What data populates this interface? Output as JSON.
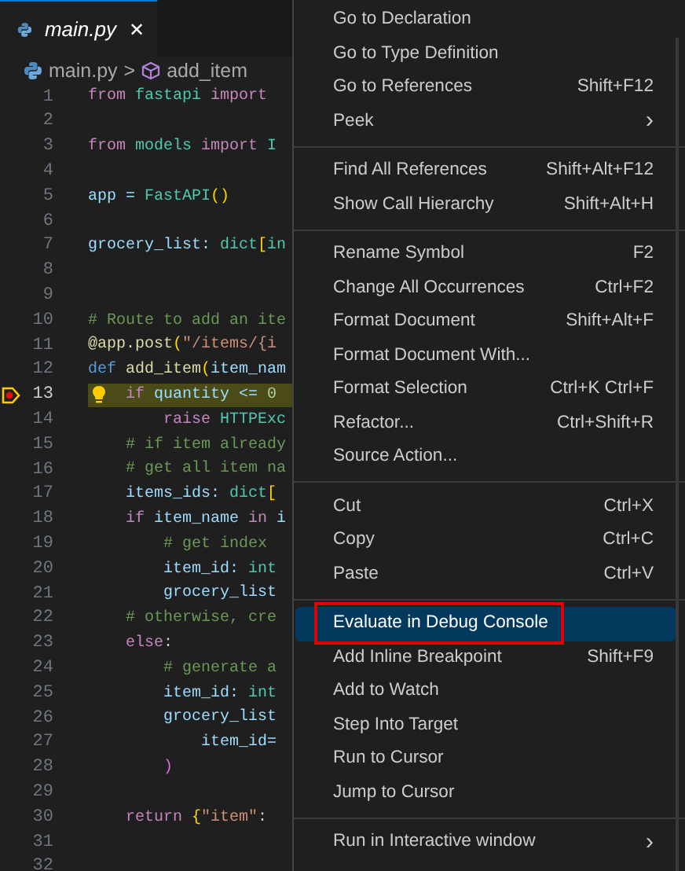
{
  "tab": {
    "label": "main.py",
    "selected": true,
    "close": "✕"
  },
  "breadcrumb": {
    "file": "main.py",
    "separator": ">",
    "symbol": "add_item"
  },
  "lines": [
    {
      "n": "1",
      "current": false,
      "tokens": [
        {
          "kind": "kw",
          "t": "from "
        },
        {
          "kind": "type",
          "t": "fastapi "
        },
        {
          "kind": "kw",
          "t": "import"
        }
      ]
    },
    {
      "n": "2",
      "current": false
    },
    {
      "n": "3",
      "current": false,
      "tokens": [
        {
          "kind": "kw",
          "t": "from "
        },
        {
          "kind": "type",
          "t": "models "
        },
        {
          "kind": "kw",
          "t": "import "
        },
        {
          "kind": "type",
          "t": "I"
        }
      ]
    },
    {
      "n": "4",
      "current": false
    },
    {
      "n": "5",
      "current": false,
      "tokens": [
        {
          "kind": "var",
          "t": "app = "
        },
        {
          "kind": "type",
          "t": "FastAPI"
        },
        {
          "kind": "br",
          "t": "()"
        }
      ]
    },
    {
      "n": "6",
      "current": false
    },
    {
      "n": "7",
      "current": false,
      "tokens": [
        {
          "kind": "var",
          "t": "grocery_list: "
        },
        {
          "kind": "type",
          "t": "dict"
        },
        {
          "kind": "br",
          "t": "["
        },
        {
          "kind": "type",
          "t": "in"
        }
      ]
    },
    {
      "n": "8",
      "current": false
    },
    {
      "n": "9",
      "current": false
    },
    {
      "n": "10",
      "current": false,
      "tokens": [
        {
          "kind": "cm",
          "t": "# Route to add an ite"
        }
      ]
    },
    {
      "n": "11",
      "current": false,
      "tokens": [
        {
          "kind": "fn",
          "t": "@app.post"
        },
        {
          "kind": "br",
          "t": "("
        },
        {
          "kind": "str",
          "t": "\"/items/{i"
        }
      ]
    },
    {
      "n": "12",
      "current": false,
      "tokens": [
        {
          "kind": "def",
          "t": "def "
        },
        {
          "kind": "fn",
          "t": "add_item"
        },
        {
          "kind": "br",
          "t": "("
        },
        {
          "kind": "var",
          "t": "item_nam"
        }
      ]
    },
    {
      "n": "13",
      "current": true,
      "tokens": [
        {
          "kind": "kw",
          "t": "if "
        },
        {
          "kind": "var",
          "t": "quantity <= "
        },
        {
          "kind": "num",
          "t": "0"
        }
      ]
    },
    {
      "n": "14",
      "current": false,
      "tokens": [
        {
          "kind": "kw",
          "t": "        raise "
        },
        {
          "kind": "type",
          "t": "HTTPExc"
        }
      ]
    },
    {
      "n": "15",
      "current": false,
      "tokens": [
        {
          "kind": "cm",
          "t": "    # if item already"
        }
      ]
    },
    {
      "n": "16",
      "current": false,
      "tokens": [
        {
          "kind": "cm",
          "t": "    # get all item na"
        }
      ]
    },
    {
      "n": "17",
      "current": false,
      "tokens": [
        {
          "kind": "var",
          "t": "    items_ids: "
        },
        {
          "kind": "type",
          "t": "dict"
        },
        {
          "kind": "br",
          "t": "["
        }
      ]
    },
    {
      "n": "18",
      "current": false,
      "tokens": [
        {
          "kind": "kw",
          "t": "    if "
        },
        {
          "kind": "var",
          "t": "item_name "
        },
        {
          "kind": "kw",
          "t": "in "
        },
        {
          "kind": "var",
          "t": "i"
        }
      ]
    },
    {
      "n": "19",
      "current": false,
      "tokens": [
        {
          "kind": "cm",
          "t": "        # get index"
        }
      ]
    },
    {
      "n": "20",
      "current": false,
      "tokens": [
        {
          "kind": "var",
          "t": "        item_id: "
        },
        {
          "kind": "type",
          "t": "int"
        }
      ]
    },
    {
      "n": "21",
      "current": false,
      "tokens": [
        {
          "kind": "var",
          "t": "        grocery_list"
        }
      ]
    },
    {
      "n": "22",
      "current": false,
      "tokens": [
        {
          "kind": "cm",
          "t": "    # otherwise, cre"
        }
      ]
    },
    {
      "n": "23",
      "current": false,
      "tokens": [
        {
          "kind": "kw",
          "t": "    else"
        },
        {
          "kind": "p",
          "t": ":"
        }
      ]
    },
    {
      "n": "24",
      "current": false,
      "tokens": [
        {
          "kind": "cm",
          "t": "        # generate a"
        }
      ]
    },
    {
      "n": "25",
      "current": false,
      "tokens": [
        {
          "kind": "var",
          "t": "        item_id: "
        },
        {
          "kind": "type",
          "t": "int"
        }
      ]
    },
    {
      "n": "26",
      "current": false,
      "tokens": [
        {
          "kind": "var",
          "t": "        grocery_list"
        }
      ]
    },
    {
      "n": "27",
      "current": false,
      "tokens": [
        {
          "kind": "var",
          "t": "            item_id="
        }
      ]
    },
    {
      "n": "28",
      "current": false,
      "tokens": [
        {
          "kind": "br2",
          "t": "        )"
        }
      ]
    },
    {
      "n": "29",
      "current": false
    },
    {
      "n": "30",
      "current": false,
      "tokens": [
        {
          "kind": "kw",
          "t": "    return "
        },
        {
          "kind": "br",
          "t": "{"
        },
        {
          "kind": "str",
          "t": "\"item\""
        },
        {
          "kind": "p",
          "t": ":"
        }
      ]
    },
    {
      "n": "31",
      "current": false
    },
    {
      "n": "32",
      "current": false
    }
  ],
  "menu": [
    [
      {
        "label": "Go to Declaration",
        "selected": false,
        "boxed": false
      },
      {
        "label": "Go to Type Definition",
        "selected": false,
        "boxed": false
      },
      {
        "label": "Go to References",
        "shortcut": "Shift+F12",
        "selected": false,
        "boxed": false
      },
      {
        "label": "Peek",
        "submenu": "›",
        "selected": false,
        "boxed": false
      }
    ],
    [
      {
        "label": "Find All References",
        "shortcut": "Shift+Alt+F12",
        "selected": false,
        "boxed": false
      },
      {
        "label": "Show Call Hierarchy",
        "shortcut": "Shift+Alt+H",
        "selected": false,
        "boxed": false
      }
    ],
    [
      {
        "label": "Rename Symbol",
        "shortcut": "F2",
        "selected": false,
        "boxed": false
      },
      {
        "label": "Change All Occurrences",
        "shortcut": "Ctrl+F2",
        "selected": false,
        "boxed": false
      },
      {
        "label": "Format Document",
        "shortcut": "Shift+Alt+F",
        "selected": false,
        "boxed": false
      },
      {
        "label": "Format Document With...",
        "selected": false,
        "boxed": false
      },
      {
        "label": "Format Selection",
        "shortcut": "Ctrl+K Ctrl+F",
        "selected": false,
        "boxed": false
      },
      {
        "label": "Refactor...",
        "shortcut": "Ctrl+Shift+R",
        "selected": false,
        "boxed": false
      },
      {
        "label": "Source Action...",
        "selected": false,
        "boxed": false
      }
    ],
    [
      {
        "label": "Cut",
        "shortcut": "Ctrl+X",
        "selected": false,
        "boxed": false
      },
      {
        "label": "Copy",
        "shortcut": "Ctrl+C",
        "selected": false,
        "boxed": false
      },
      {
        "label": "Paste",
        "shortcut": "Ctrl+V",
        "selected": false,
        "boxed": false
      }
    ],
    [
      {
        "label": "Evaluate in Debug Console",
        "selected": true,
        "boxed": true
      },
      {
        "label": "Add Inline Breakpoint",
        "shortcut": "Shift+F9",
        "selected": false,
        "boxed": false
      },
      {
        "label": "Add to Watch",
        "selected": false,
        "boxed": false
      },
      {
        "label": "Step Into Target",
        "selected": false,
        "boxed": false
      },
      {
        "label": "Run to Cursor",
        "selected": false,
        "boxed": false
      },
      {
        "label": "Jump to Cursor",
        "selected": false,
        "boxed": false
      }
    ],
    [
      {
        "label": "Run in Interactive window",
        "submenu": "›",
        "selected": false,
        "boxed": false
      }
    ]
  ]
}
